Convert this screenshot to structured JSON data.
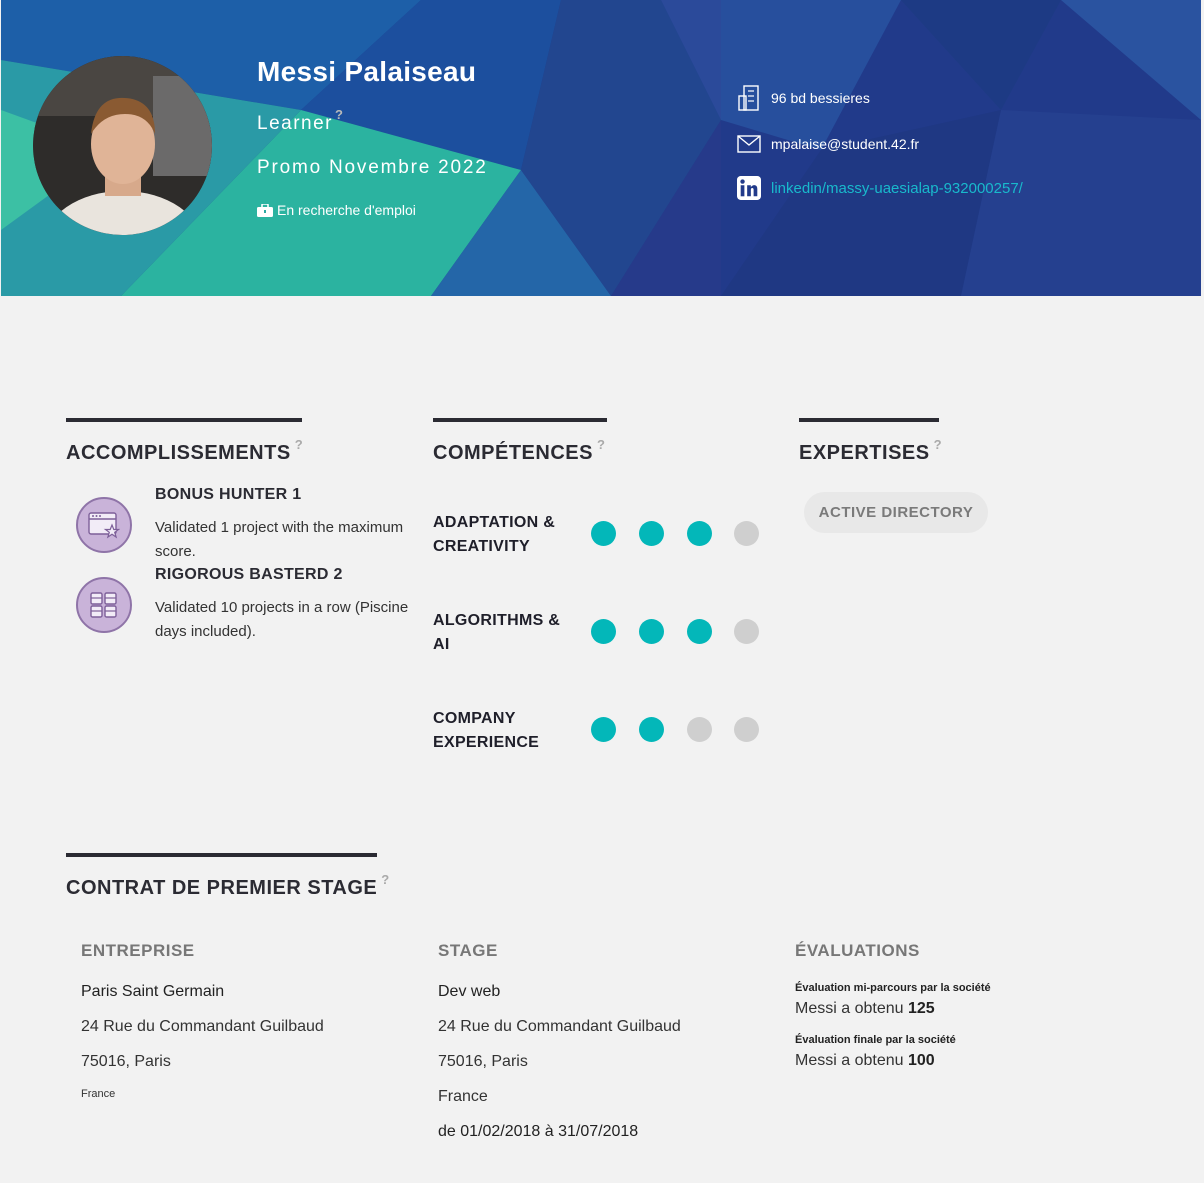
{
  "profile": {
    "name": "Messi Palaiseau",
    "role": "Learner",
    "role_help": "?",
    "promo": "Promo Novembre 2022",
    "job_status": "En recherche d'emploi"
  },
  "contact": {
    "address": "96 bd bessieres",
    "email": "mpalaise@student.42.fr",
    "linkedin": "linkedin/massy-uaesialap-932000257/"
  },
  "accomplishments": {
    "title": "ACCOMPLISSEMENTS",
    "help": "?",
    "items": [
      {
        "title": "BONUS HUNTER 1",
        "description": "Validated 1 project with the maximum score.",
        "icon": "window-star-icon"
      },
      {
        "title": "RIGOROUS BASTERD 2",
        "description": "Validated 10 projects in a row (Piscine days included).",
        "icon": "grid-blocks-icon"
      }
    ]
  },
  "skills": {
    "title": "COMPÉTENCES",
    "help": "?",
    "max_level": 4,
    "items": [
      {
        "label": "ADAPTATION & CREATIVITY",
        "level": 3
      },
      {
        "label": "ALGORITHMS & AI",
        "level": 3
      },
      {
        "label": "COMPANY EXPERIENCE",
        "level": 2
      }
    ],
    "colors": {
      "filled": "#03b7b9",
      "empty": "#cfcfcf"
    }
  },
  "expertises": {
    "title": "EXPERTISES",
    "help": "?",
    "items": [
      "ACTIVE DIRECTORY"
    ]
  },
  "internship": {
    "title": "CONTRAT DE PREMIER STAGE",
    "help": "?",
    "company": {
      "heading": "ENTREPRISE",
      "name": "Paris Saint Germain",
      "street": "24 Rue du Commandant Guilbaud",
      "city": "75016, Paris",
      "country": "France"
    },
    "stage": {
      "heading": "STAGE",
      "name": "Dev web",
      "street": "24 Rue du Commandant Guilbaud",
      "city": "75016, Paris",
      "country": "France",
      "dates": "de 01/02/2018 à 31/07/2018"
    },
    "evaluations": {
      "heading": "ÉVALUATIONS",
      "items": [
        {
          "label": "Évaluation mi-parcours par la société",
          "prefix": "Messi a obtenu",
          "score": "125"
        },
        {
          "label": "Évaluation finale par la société",
          "prefix": "Messi a obtenu",
          "score": "100"
        }
      ]
    }
  }
}
